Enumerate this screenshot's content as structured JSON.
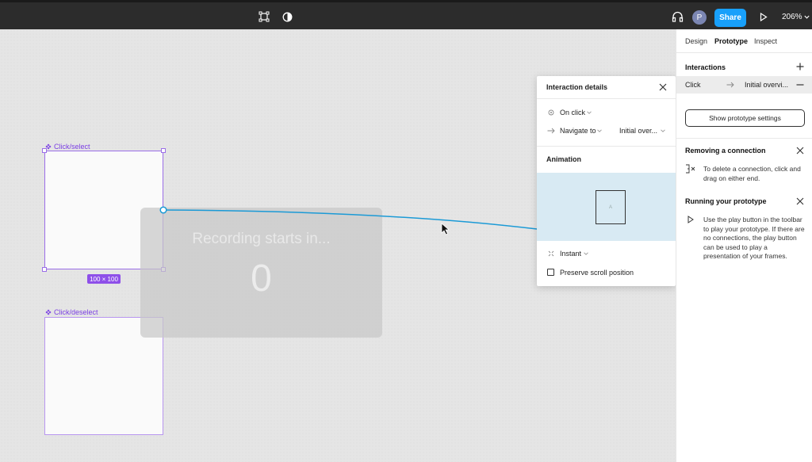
{
  "toolbar": {
    "share_label": "Share",
    "zoom_label": "206%",
    "avatar_initial": "P",
    "icons": [
      "frame-tool-icon",
      "contrast-icon",
      "headphones-icon",
      "play-icon",
      "chevron-down-icon"
    ]
  },
  "canvas": {
    "frame_select_label": "Click/select",
    "frame_deselect_label": "Click/deselect",
    "size_badge": "100 × 100",
    "recording_title": "Recording starts in...",
    "recording_count": "0"
  },
  "popup": {
    "title": "Interaction details",
    "trigger": "On click",
    "action": "Navigate to",
    "destination": "Initial over...",
    "animation_title": "Animation",
    "preview_label": "A",
    "animation_type": "Instant",
    "preserve_scroll": "Preserve scroll position"
  },
  "panel": {
    "tabs": [
      "Design",
      "Prototype",
      "Inspect"
    ],
    "active_tab": "Prototype",
    "interactions_title": "Interactions",
    "interaction_trigger": "Click",
    "interaction_target": "Initial overvi...",
    "settings_button": "Show prototype settings",
    "tip1_title": "Removing a connection",
    "tip1_text": "To delete a connection, click and drag on either end.",
    "tip2_title": "Running your prototype",
    "tip2_text": "Use the play button in the toolbar to play your prototype. If there are no connections, the play button can be used to play a presentation of your frames."
  },
  "colors": {
    "accent": "#18a0fb",
    "selection": "#8e4fe9",
    "connector": "#1b9ad6"
  }
}
